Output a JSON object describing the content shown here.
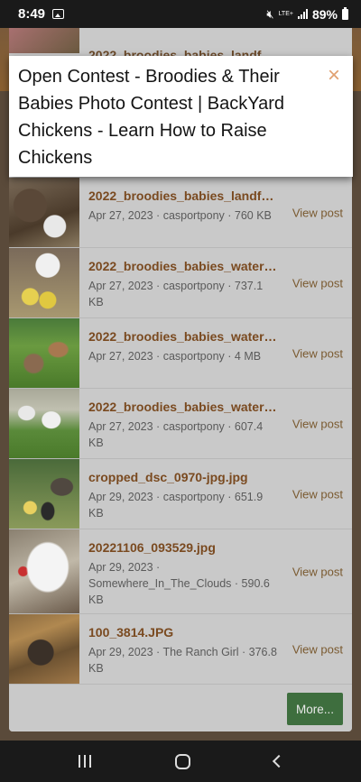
{
  "status_bar": {
    "time": "8:49",
    "lte_label": "LTE+",
    "battery": "89%"
  },
  "background": {
    "peek_title": "2022_broodies_babies_landf..."
  },
  "modal": {
    "title": "Open Contest - Broodies & Their Babies Photo Contest | BackYard Chickens - Learn How to Raise Chickens",
    "close_glyph": "×"
  },
  "attachments": [
    {
      "filename": "2022_broodies_babies_landfo...",
      "meta": "Apr 27, 2023 · casportpony · 760 KB",
      "action": "View post"
    },
    {
      "filename": "2022_broodies_babies_waterf...",
      "meta": "Apr 27, 2023 · casportpony · 737.1 KB",
      "action": "View post"
    },
    {
      "filename": "2022_broodies_babies_waterf...",
      "meta": "Apr 27, 2023 · casportpony · 4 MB",
      "action": "View post"
    },
    {
      "filename": "2022_broodies_babies_waterf...",
      "meta": "Apr 27, 2023 · casportpony · 607.4 KB",
      "action": "View post"
    },
    {
      "filename": "cropped_dsc_0970-jpg.jpg",
      "meta": "Apr 29, 2023 · casportpony · 651.9 KB",
      "action": "View post"
    },
    {
      "filename": "20221106_093529.jpg",
      "meta": "Apr 29, 2023 · Somewhere_In_The_Clouds · 590.6 KB",
      "action": "View post"
    },
    {
      "filename": "100_3814.JPG",
      "meta": "Apr 29, 2023 · The Ranch Girl · 376.8 KB",
      "action": "View post"
    }
  ],
  "more_button": "More...",
  "nav": {
    "recent_icon": "recent-apps-icon",
    "home_icon": "home-icon",
    "back_icon": "back-icon"
  }
}
